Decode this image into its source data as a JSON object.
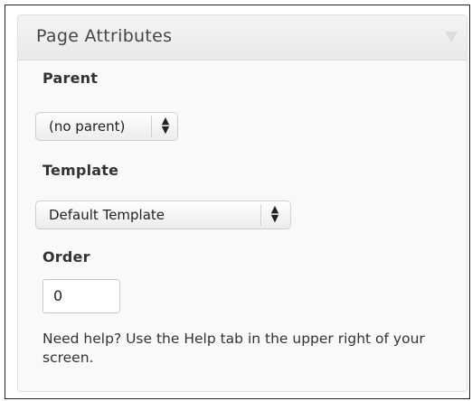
{
  "panel": {
    "title": "Page Attributes",
    "toggle_icon": "triangle-down-icon"
  },
  "parent": {
    "label": "Parent",
    "selected": "(no parent)"
  },
  "template": {
    "label": "Template",
    "selected": "Default Template"
  },
  "order": {
    "label": "Order",
    "value": "0"
  },
  "help_text": "Need help? Use the Help tab in the upper right of your screen.",
  "colors": {
    "header_bg": "#ececec",
    "panel_bg": "#f9f9f9",
    "text": "#333333",
    "border": "#dfdfdf"
  }
}
